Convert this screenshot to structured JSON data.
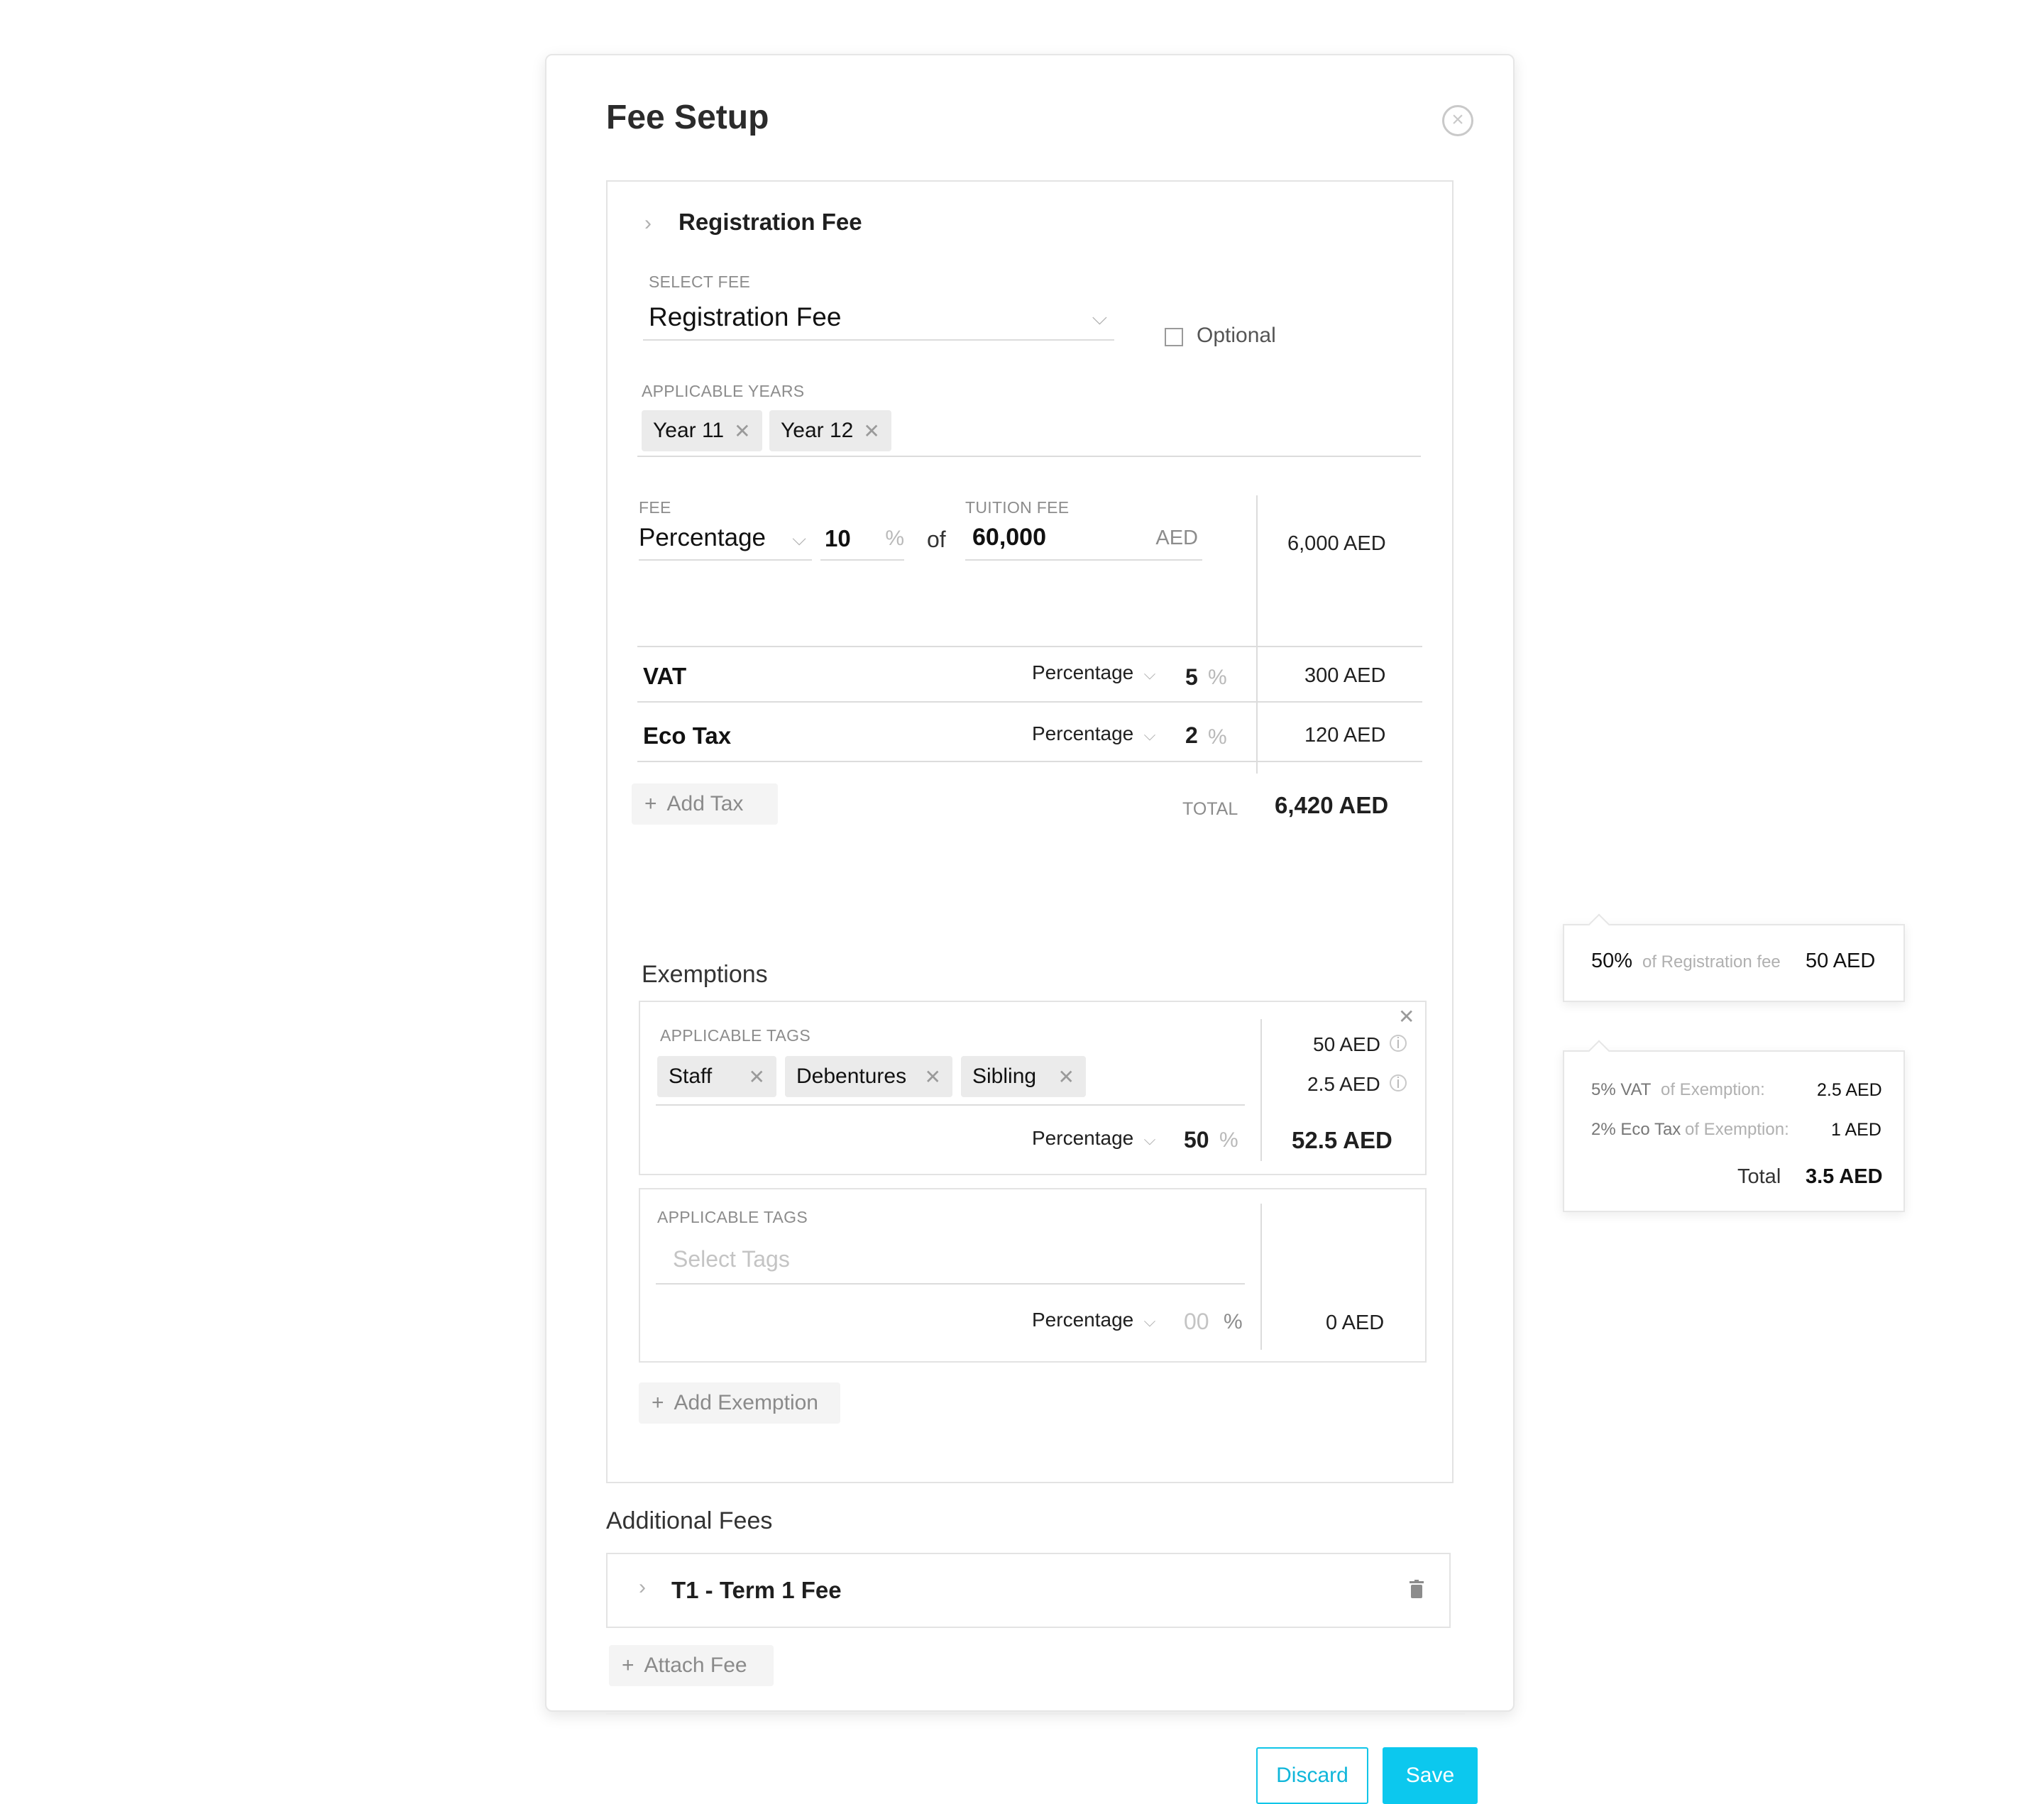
{
  "modal": {
    "title": "Fee Setup"
  },
  "registration": {
    "header": "Registration Fee",
    "select_fee_label": "SELECT FEE",
    "select_fee_value": "Registration Fee",
    "optional_label": "Optional",
    "applicable_years_label": "APPLICABLE YEARS",
    "years": [
      "Year 11",
      "Year 12"
    ],
    "fee_label": "FEE",
    "fee_type": "Percentage",
    "fee_value": "10",
    "percent_sign": "%",
    "of_text": "of",
    "tuition_label": "TUITION FEE",
    "tuition_value": "60,000",
    "tuition_currency": "AED",
    "fee_amount": "6,000 AED",
    "taxes": [
      {
        "name": "VAT",
        "type": "Percentage",
        "value": "5",
        "unit": "%",
        "amount": "300 AED"
      },
      {
        "name": "Eco Tax",
        "type": "Percentage",
        "value": "2",
        "unit": "%",
        "amount": "120 AED"
      }
    ],
    "add_tax": "Add Tax",
    "total_label": "TOTAL",
    "total_value": "6,420 AED"
  },
  "exemptions": {
    "heading": "Exemptions",
    "items": [
      {
        "tags_label": "APPLICABLE TAGS",
        "tags": [
          "Staff",
          "Debentures",
          "Sibling"
        ],
        "type": "Percentage",
        "value": "50",
        "unit": "%",
        "line1": "50 AED",
        "line2": "2.5 AED",
        "total": "52.5 AED"
      },
      {
        "tags_label": "APPLICABLE TAGS",
        "placeholder": "Select Tags",
        "type": "Percentage",
        "value": "00",
        "unit": "%",
        "total": "0 AED"
      }
    ],
    "add_exemption": "Add Exemption"
  },
  "additional": {
    "heading": "Additional Fees",
    "items": [
      {
        "label": "T1 - Term 1 Fee"
      }
    ],
    "attach_fee": "Attach Fee"
  },
  "footer": {
    "discard": "Discard",
    "save": "Save"
  },
  "tooltip1": {
    "percent": "50%",
    "desc": "of Registration fee",
    "amount": "50 AED"
  },
  "tooltip2": {
    "rows": [
      {
        "a": "5% VAT",
        "b": "of Exemption:",
        "amount": "2.5 AED"
      },
      {
        "a": "2% Eco Tax",
        "b": "of Exemption:",
        "amount": "1 AED"
      }
    ],
    "total_label": "Total",
    "total_value": "3.5 AED"
  },
  "colors": {
    "accent": "#0cc8ee",
    "border": "#e3e3e3"
  }
}
